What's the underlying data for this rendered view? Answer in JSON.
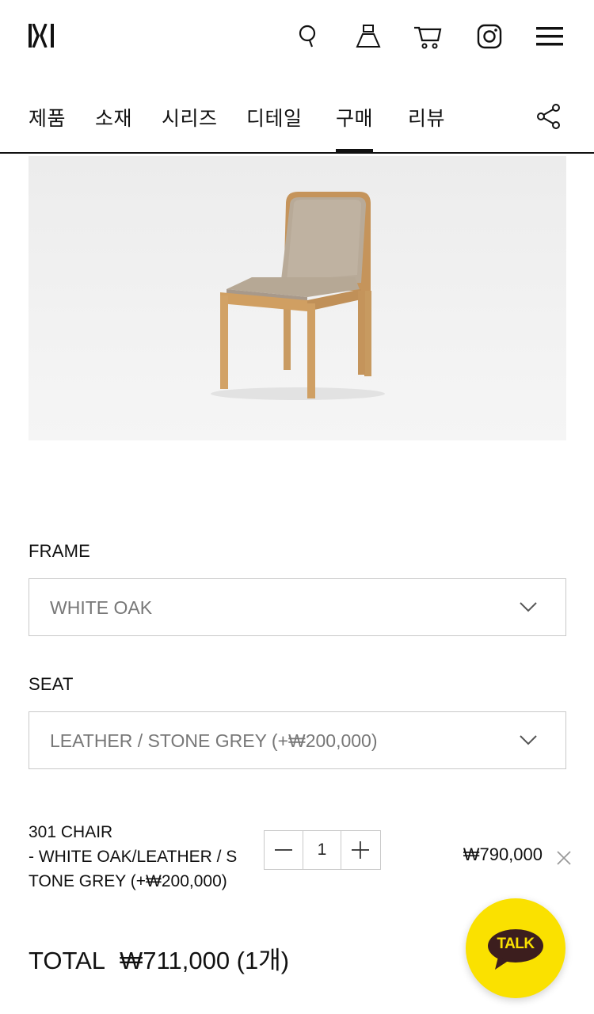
{
  "brand": {
    "logo_icon": "brand-logo-icon"
  },
  "header": {
    "icons": [
      "search-icon",
      "lamp-icon",
      "cart-icon",
      "instagram-icon",
      "hamburger-menu-icon"
    ]
  },
  "tabs": [
    {
      "label": "제품",
      "active": false
    },
    {
      "label": "소재",
      "active": false
    },
    {
      "label": "시리즈",
      "active": false
    },
    {
      "label": "디테일",
      "active": false
    },
    {
      "label": "구매",
      "active": true
    },
    {
      "label": "리뷰",
      "active": false
    }
  ],
  "share_icon": "share-icon",
  "options": {
    "frame": {
      "label": "FRAME",
      "value": "WHITE OAK"
    },
    "seat": {
      "label": "SEAT",
      "value": "LEATHER / STONE GREY (+₩200,000)"
    }
  },
  "cart_item": {
    "name_line1": "301 CHAIR",
    "name_line2": "- WHITE OAK/LEATHER / S",
    "name_line3": "TONE GREY (+₩200,000)",
    "quantity": "1",
    "price": "₩790,000"
  },
  "total": {
    "label": "TOTAL",
    "value": "₩711,000 (1개)"
  },
  "talk_button": {
    "label": "TALK"
  },
  "colors": {
    "accent": "#111111",
    "talk_yellow": "#fae100",
    "talk_brown": "#3c1e1e",
    "border": "#c9c9c9"
  }
}
